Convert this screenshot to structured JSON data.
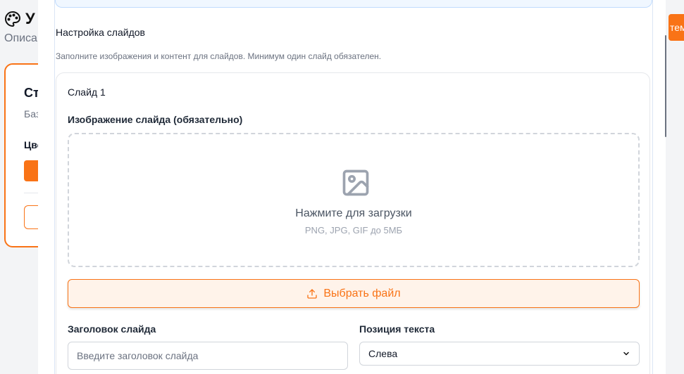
{
  "background": {
    "title": "У",
    "subtitle": "Описа",
    "card_title": "Ст",
    "card_subtitle": "Баз",
    "card_label": "Цве",
    "right_button": "тем",
    "accent": "#f97316"
  },
  "modal": {
    "section_title": "Настройка слайдов",
    "section_description": "Заполните изображения и контент для слайдов. Минимум один слайд обязателен.",
    "slide": {
      "title": "Слайд 1",
      "image_label": "Изображение слайда (обязательно)",
      "dropzone_title": "Нажмите для загрузки",
      "dropzone_hint": "PNG, JPG, GIF до 5МБ",
      "choose_file_label": "Выбрать файл",
      "heading_label": "Заголовок слайда",
      "heading_placeholder": "Введите заголовок слайда",
      "heading_value": "",
      "position_label": "Позиция текста",
      "position_value": "Слева"
    }
  },
  "icons": {
    "palette": "palette-icon",
    "image": "image-icon",
    "upload": "upload-icon",
    "chevron": "chevron-down-icon"
  }
}
